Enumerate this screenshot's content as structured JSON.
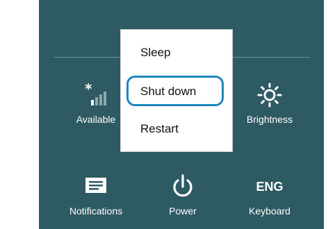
{
  "settings_panel": {
    "tiles": {
      "available": {
        "label": "Available",
        "icon": "network-signal-icon"
      },
      "brightness": {
        "label": "Brightness",
        "icon": "brightness-sun-icon"
      },
      "notifications": {
        "label": "Notifications",
        "icon": "notifications-icon"
      },
      "power": {
        "label": "Power",
        "icon": "power-icon"
      },
      "keyboard": {
        "label": "Keyboard",
        "glyph": "ENG"
      }
    }
  },
  "power_menu": {
    "items": [
      {
        "label": "Sleep"
      },
      {
        "label": "Shut down",
        "focused": true
      },
      {
        "label": "Restart"
      }
    ]
  },
  "colors": {
    "panel_background": "#2e5b63",
    "focus_ring": "#1e86bf",
    "menu_background": "#ffffff"
  }
}
